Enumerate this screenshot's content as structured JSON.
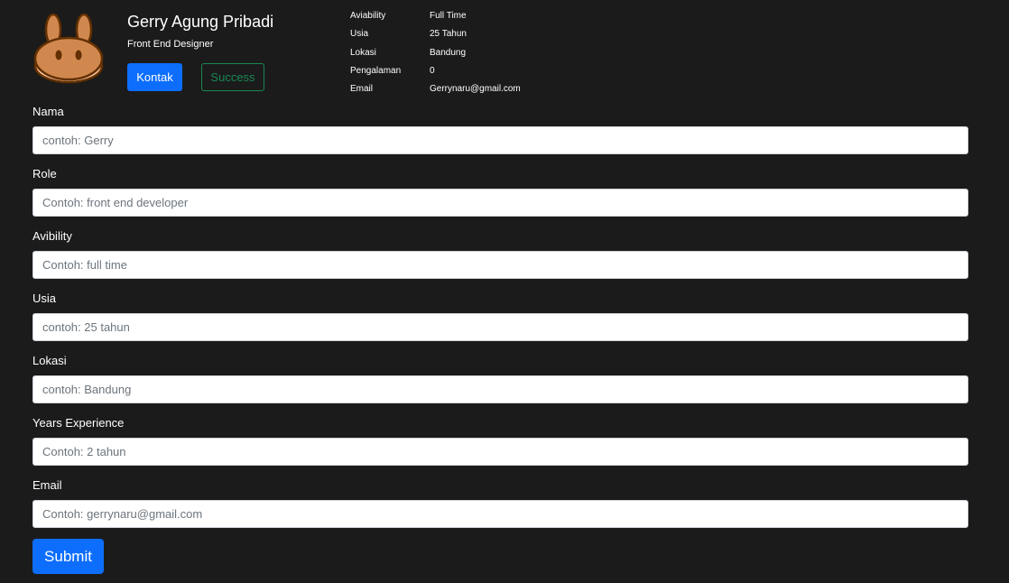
{
  "profile": {
    "name": "Gerry Agung Pribadi",
    "role": "Front End Designer",
    "avatar_icon": "pancake-bunny-logo-icon",
    "contact_button": "Kontak",
    "success_button": "Success"
  },
  "info": {
    "rows": [
      {
        "label": "Aviability",
        "value": "Full Time"
      },
      {
        "label": "Usia",
        "value": "25 Tahun"
      },
      {
        "label": "Lokasi",
        "value": "Bandung"
      },
      {
        "label": "Pengalaman",
        "value": "0"
      },
      {
        "label": "Email",
        "value": "Gerrynaru@gmail.com"
      }
    ]
  },
  "form": {
    "fields": [
      {
        "label": "Nama",
        "placeholder": "contoh: Gerry",
        "value": ""
      },
      {
        "label": "Role",
        "placeholder": "Contoh: front end developer",
        "value": ""
      },
      {
        "label": "Avibility",
        "placeholder": "Contoh: full time",
        "value": ""
      },
      {
        "label": "Usia",
        "placeholder": "contoh: 25 tahun",
        "value": ""
      },
      {
        "label": "Lokasi",
        "placeholder": "contoh: Bandung",
        "value": ""
      },
      {
        "label": "Years Experience",
        "placeholder": "Contoh: 2 tahun",
        "value": ""
      },
      {
        "label": "Email",
        "placeholder": "Contoh: gerrynaru@gmail.com",
        "value": ""
      }
    ],
    "submit_label": "Submit"
  },
  "colors": {
    "background": "#1b1b1b",
    "primary": "#0d6efd",
    "success": "#198754",
    "avatar_orange": "#d1884f",
    "avatar_outline": "#633001"
  }
}
